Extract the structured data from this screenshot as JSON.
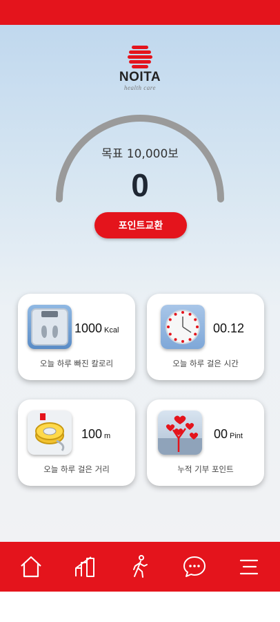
{
  "app": {
    "brand_name": "NOITA",
    "brand_tagline": "health care"
  },
  "goal": {
    "label": "목표 10,000보",
    "steps": "0",
    "progress_fraction": 0
  },
  "point_exchange_button": "포인트교환",
  "cards": [
    {
      "value": "1000",
      "unit": "Kcal",
      "caption": "오늘 하루 빠진 칼로리",
      "icon": "scale-icon"
    },
    {
      "value": "00.12",
      "unit": "",
      "caption": "오늘 하루 걸은 시간",
      "icon": "clock-icon"
    },
    {
      "value": "100",
      "unit": "m",
      "caption": "오늘 하루 걸은 거리",
      "icon": "tape-measure-icon"
    },
    {
      "value": "00",
      "unit": "Pint",
      "caption": "누적 기부 포인트",
      "icon": "heart-tree-icon"
    }
  ],
  "nav": [
    "home-icon",
    "stats-icon",
    "walking-icon",
    "chat-icon",
    "menu-icon"
  ],
  "colors": {
    "accent": "#e4141c",
    "gauge_track": "#9a9a9a"
  }
}
